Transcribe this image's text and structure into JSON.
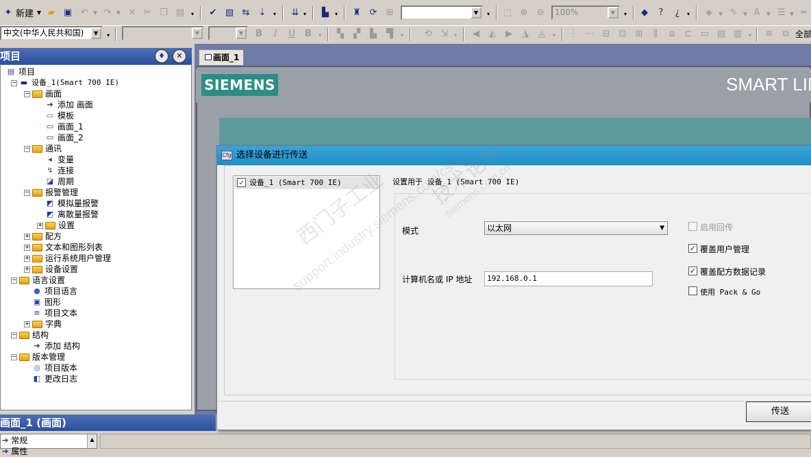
{
  "toolbar1": {
    "new_label": "新建",
    "zoom_value": "100%",
    "search_value": ""
  },
  "toolbar2": {
    "language_value": "中文(中华人民共和国)",
    "right_label": "全部"
  },
  "project": {
    "title": "项目",
    "tree": [
      {
        "label": "项目",
        "depth": 0,
        "icon": "project-icon",
        "expander": "none"
      },
      {
        "label": "设备_1(Smart 700 IE)",
        "depth": 1,
        "icon": "device-icon",
        "expander": "minus"
      },
      {
        "label": "画面",
        "depth": 2,
        "icon": "folder-icon",
        "expander": "minus"
      },
      {
        "label": "添加 画面",
        "depth": 3,
        "icon": "add-arrow-icon",
        "expander": "none"
      },
      {
        "label": "模板",
        "depth": 3,
        "icon": "template-icon",
        "expander": "none"
      },
      {
        "label": "画面_1",
        "depth": 3,
        "icon": "screen-icon",
        "expander": "none"
      },
      {
        "label": "画面_2",
        "depth": 3,
        "icon": "screen-icon",
        "expander": "none"
      },
      {
        "label": "通讯",
        "depth": 2,
        "icon": "folder-icon",
        "expander": "minus"
      },
      {
        "label": "变量",
        "depth": 3,
        "icon": "tag-icon",
        "expander": "none"
      },
      {
        "label": "连接",
        "depth": 3,
        "icon": "connection-icon",
        "expander": "none"
      },
      {
        "label": "周期",
        "depth": 3,
        "icon": "cycle-icon",
        "expander": "none"
      },
      {
        "label": "报警管理",
        "depth": 2,
        "icon": "folder-icon",
        "expander": "minus"
      },
      {
        "label": "模拟量报警",
        "depth": 3,
        "icon": "alarm-icon",
        "expander": "none"
      },
      {
        "label": "离散量报警",
        "depth": 3,
        "icon": "alarm-icon",
        "expander": "none"
      },
      {
        "label": "设置",
        "depth": 3,
        "icon": "folder-icon",
        "expander": "plus"
      },
      {
        "label": "配方",
        "depth": 2,
        "icon": "folder-icon",
        "expander": "plus"
      },
      {
        "label": "文本和图形列表",
        "depth": 2,
        "icon": "folder-icon",
        "expander": "plus"
      },
      {
        "label": "运行系统用户管理",
        "depth": 2,
        "icon": "folder-icon",
        "expander": "plus"
      },
      {
        "label": "设备设置",
        "depth": 2,
        "icon": "folder-icon",
        "expander": "plus"
      },
      {
        "label": "语言设置",
        "depth": 1,
        "icon": "folder-icon",
        "expander": "minus"
      },
      {
        "label": "项目语言",
        "depth": 2,
        "icon": "globe-icon",
        "expander": "none"
      },
      {
        "label": "图形",
        "depth": 2,
        "icon": "graphic-icon",
        "expander": "none"
      },
      {
        "label": "项目文本",
        "depth": 2,
        "icon": "text-icon",
        "expander": "none"
      },
      {
        "label": "字典",
        "depth": 2,
        "icon": "folder-icon",
        "expander": "plus"
      },
      {
        "label": "结构",
        "depth": 1,
        "icon": "folder-icon",
        "expander": "minus"
      },
      {
        "label": "添加 结构",
        "depth": 2,
        "icon": "add-arrow-icon",
        "expander": "none"
      },
      {
        "label": "版本管理",
        "depth": 1,
        "icon": "folder-icon",
        "expander": "minus"
      },
      {
        "label": "项目版本",
        "depth": 2,
        "icon": "database-icon",
        "expander": "none"
      },
      {
        "label": "更改日志",
        "depth": 2,
        "icon": "log-icon",
        "expander": "none"
      }
    ]
  },
  "workspace": {
    "tab_label": "画面_1",
    "logo_text": "SIEMENS",
    "brand_text": "SMART LIN"
  },
  "dialog": {
    "title": "选择设备进行传送",
    "icon_text": "Cfg",
    "device_item": "设备_1 (Smart 700 IE)",
    "device_checked": true,
    "settings_for": "设置用于 设备_1 (Smart 700 IE)",
    "mode_label": "模式",
    "mode_value": "以太网",
    "ip_label": "计算机名或 IP 地址",
    "ip_value": "192.168.0.1",
    "options": [
      {
        "label": "启用回传",
        "checked": false,
        "enabled": false
      },
      {
        "label": "覆盖用户管理",
        "checked": true,
        "enabled": true
      },
      {
        "label": "覆盖配方数据记录",
        "checked": true,
        "enabled": true
      },
      {
        "label": "使用 Pack & Go",
        "checked": false,
        "enabled": true
      }
    ],
    "transfer_button": "传送"
  },
  "watermark": {
    "line1": "西门子工业",
    "line2": "support.industry.siemens.com/cs",
    "line3": "技术论坛",
    "line4": "siemens.com.cn"
  },
  "bottom": {
    "title": "画面_1 (画面)",
    "list_items": [
      "常规",
      "属性"
    ]
  }
}
